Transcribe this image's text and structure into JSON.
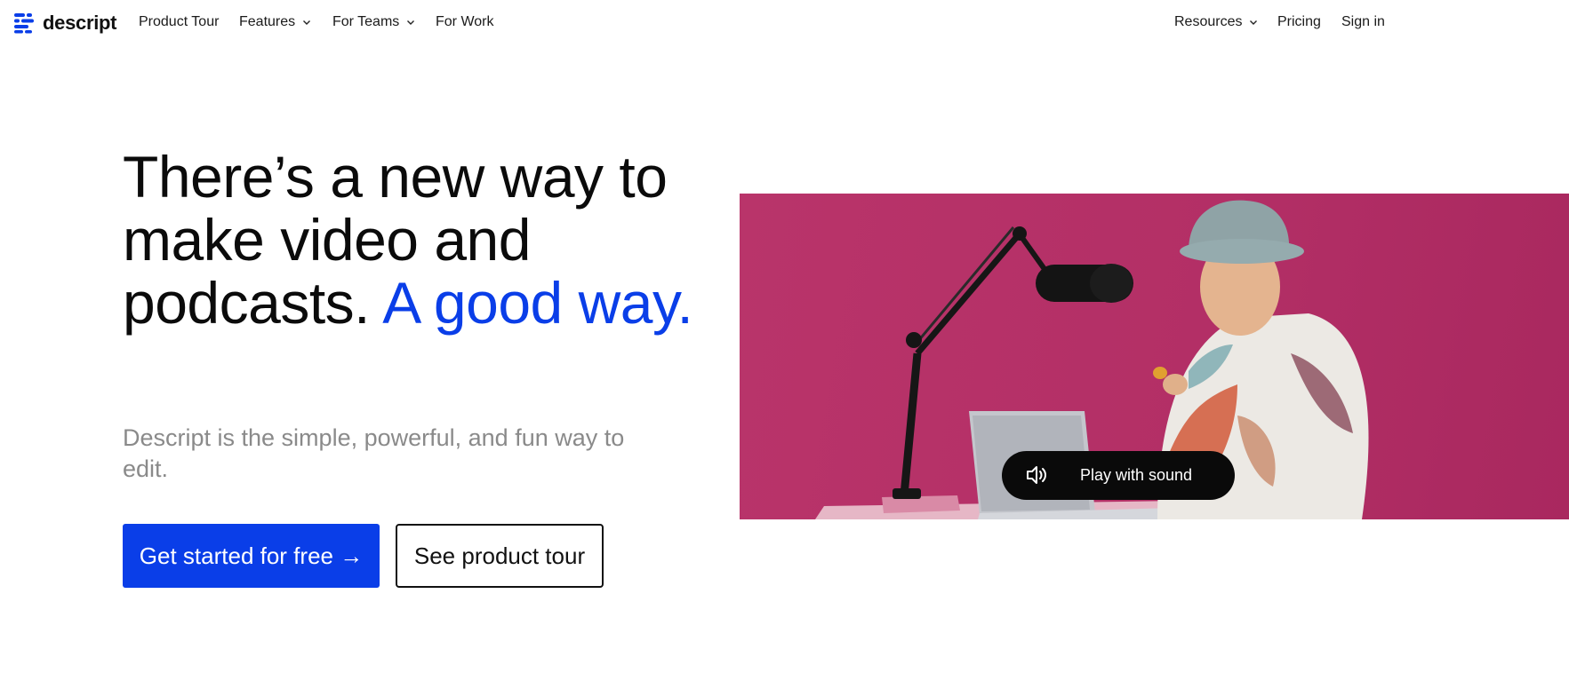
{
  "brand": {
    "name": "descript",
    "color": "#0a3ee8"
  },
  "nav": {
    "left": [
      {
        "label": "Product Tour",
        "has_dropdown": false
      },
      {
        "label": "Features",
        "has_dropdown": true
      },
      {
        "label": "For Teams",
        "has_dropdown": true
      },
      {
        "label": "For Work",
        "has_dropdown": false
      }
    ],
    "right": [
      {
        "label": "Resources",
        "has_dropdown": true
      },
      {
        "label": "Pricing",
        "has_dropdown": false
      },
      {
        "label": "Sign in",
        "has_dropdown": false
      }
    ]
  },
  "hero": {
    "headline_main": "There’s a new way to make video and podcasts.",
    "headline_accent": "A good way.",
    "subhead": "Descript is the simple, powerful, and fun way to edit.",
    "cta_primary": "Get started for free →",
    "cta_secondary": "See product tour"
  },
  "video": {
    "play_label": "Play with sound",
    "play_icon": "speaker-icon",
    "background_color": "#b3306a"
  }
}
